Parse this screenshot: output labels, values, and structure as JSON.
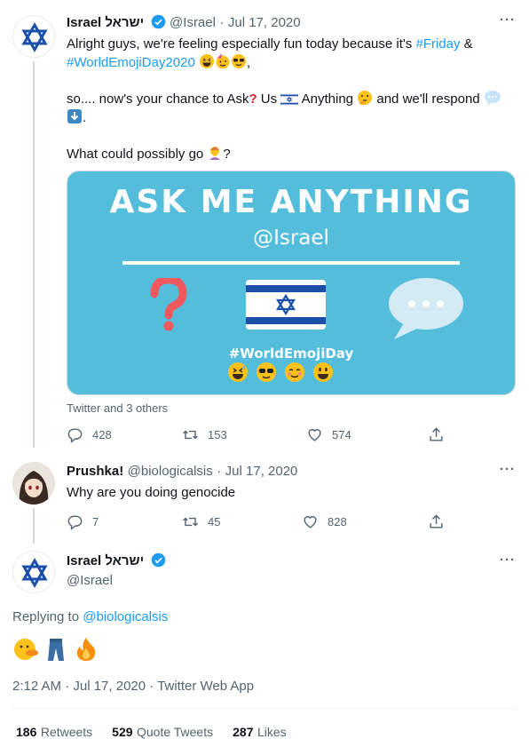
{
  "colors": {
    "accent": "#1d9bf0",
    "card_bg": "#54bddb",
    "muted": "#536471"
  },
  "tweet1": {
    "name": "Israel ישראל",
    "handle": "@Israel",
    "sep": "·",
    "date": "Jul 17, 2020",
    "line1_a": "Alright guys, we're feeling especially fun today because it's ",
    "hashtag_friday": "#Friday",
    "line1_b": " &",
    "hashtag_emojiday": "#WorldEmojiDay2020",
    "line3_a": "so.... now's your chance to Ask",
    "line3_b": " Us ",
    "line3_c": " Anything ",
    "line3_d": " and we'll respond",
    "line3_e": ".",
    "line4_a": "What could possibly go ",
    "line4_b": "?",
    "card": {
      "title": "ASK ME ANYTHING",
      "handle": "@Israel",
      "hashtag": "#WorldEmojiDay"
    },
    "tagged": "Twitter and 3 others",
    "replies": "428",
    "retweets": "153",
    "likes": "574"
  },
  "tweet2": {
    "name": "Prushka!",
    "handle": "@biologicalsis",
    "sep": "·",
    "date": "Jul 17, 2020",
    "text": "Why are you doing genocide",
    "replies": "7",
    "retweets": "45",
    "likes": "828"
  },
  "tweet3": {
    "name": "Israel ישראל",
    "handle": "@Israel",
    "replying_label": "Replying to ",
    "replying_to": "@biologicalsis",
    "timestamp": "2:12 AM · Jul 17, 2020 · Twitter Web App",
    "stats": [
      {
        "num": "186",
        "label": "Retweets"
      },
      {
        "num": "529",
        "label": "Quote Tweets"
      },
      {
        "num": "287",
        "label": "Likes"
      }
    ]
  }
}
